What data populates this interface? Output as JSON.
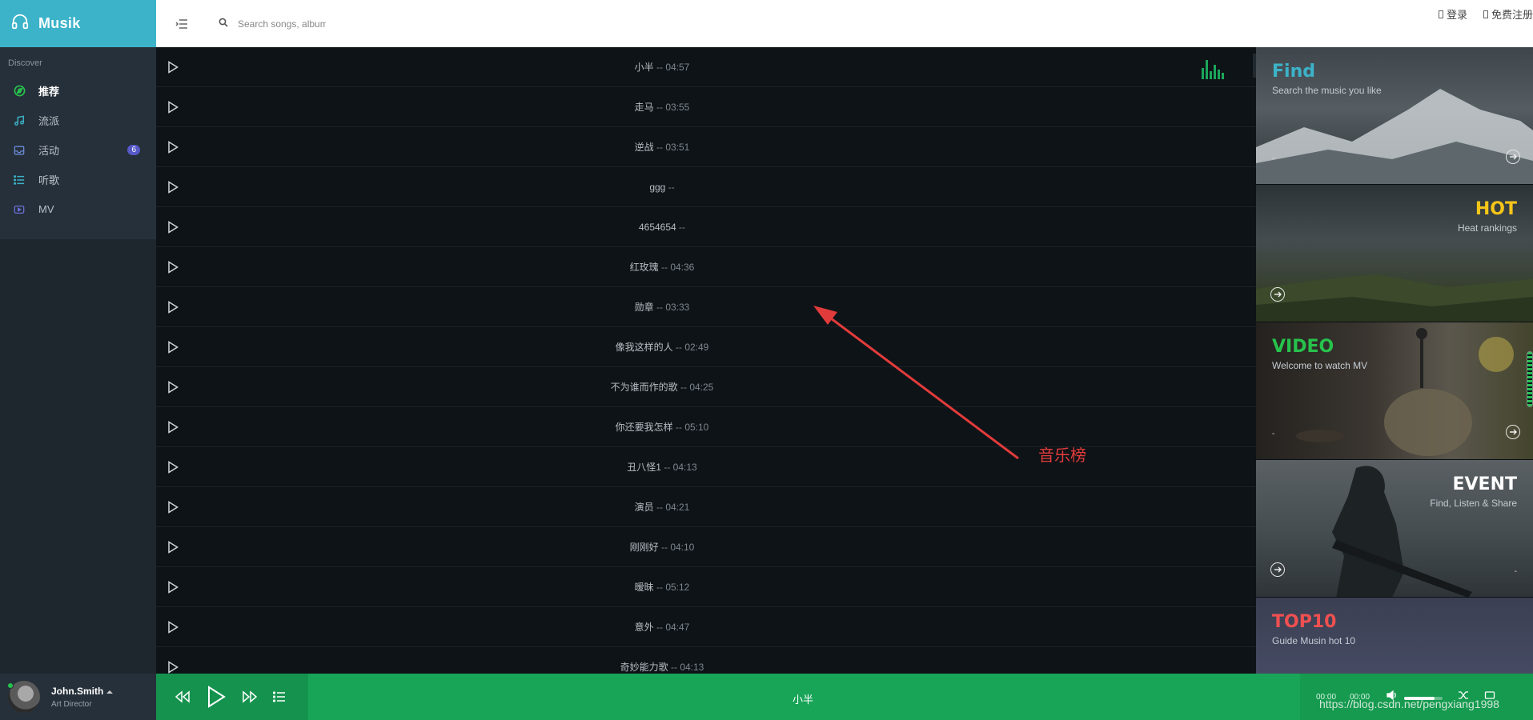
{
  "app": {
    "name": "Musik"
  },
  "search": {
    "placeholder": "Search songs, albums..."
  },
  "auth": {
    "login": "登录",
    "register": "免费注册"
  },
  "sidebar": {
    "group": "Discover",
    "items": [
      {
        "label": "推荐",
        "icon": "compass-icon",
        "active": true
      },
      {
        "label": "流派",
        "icon": "music-note-icon"
      },
      {
        "label": "活动",
        "icon": "inbox-icon",
        "badge": "6"
      },
      {
        "label": "听歌",
        "icon": "list-icon"
      },
      {
        "label": "MV",
        "icon": "video-icon"
      }
    ]
  },
  "user": {
    "name": "John.Smith",
    "role": "Art Director"
  },
  "songs": [
    {
      "title": "小半",
      "duration": "04:57"
    },
    {
      "title": "走马",
      "duration": "03:55"
    },
    {
      "title": "逆战",
      "duration": "03:51"
    },
    {
      "title": "ggg",
      "duration": ""
    },
    {
      "title": "4654654",
      "duration": ""
    },
    {
      "title": "红玫瑰",
      "duration": "04:36"
    },
    {
      "title": "勋章",
      "duration": "03:33"
    },
    {
      "title": "像我这样的人",
      "duration": "02:49"
    },
    {
      "title": "不为谁而作的歌",
      "duration": "04:25"
    },
    {
      "title": "你还要我怎样",
      "duration": "05:10"
    },
    {
      "title": "丑八怪1",
      "duration": "04:13"
    },
    {
      "title": "演员",
      "duration": "04:21"
    },
    {
      "title": "刚刚好",
      "duration": "04:10"
    },
    {
      "title": "暧昧",
      "duration": "05:12"
    },
    {
      "title": "意外",
      "duration": "04:47"
    },
    {
      "title": "奇妙能力歌",
      "duration": "04:13"
    }
  ],
  "separator": " -- ",
  "annotation": {
    "label": "音乐榜",
    "color": "#e23b3b"
  },
  "cards": [
    {
      "title": "Find",
      "subtitle": "Search the music you like",
      "color": "#3cb3c9",
      "tick": "-"
    },
    {
      "title": "HOT",
      "subtitle": "Heat rankings",
      "color": "#f5c518"
    },
    {
      "title": "VIDEO",
      "subtitle": "Welcome to watch MV",
      "color": "#27c24c",
      "tick": "-"
    },
    {
      "title": "EVENT",
      "subtitle": "Find, Listen & Share",
      "color": "#ffffff",
      "tick": "-"
    },
    {
      "title": "TOP10",
      "subtitle": "Guide Musin hot 10",
      "color": "#f05050"
    }
  ],
  "player": {
    "now_playing": "小半",
    "current_time": "00:00",
    "total_time": "00:00",
    "volume": 0.8
  },
  "watermark": "https://blog.csdn.net/pengxiang1998",
  "colors": {
    "brand": "#3cb3c9",
    "player": "#18a558",
    "accent": "#27c24c"
  }
}
